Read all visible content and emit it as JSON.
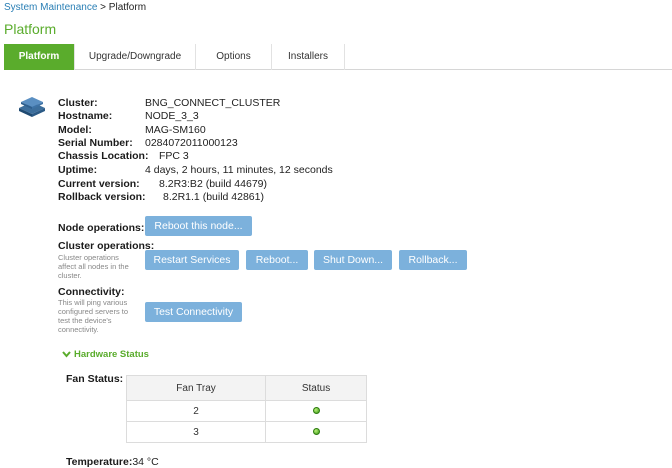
{
  "breadcrumb": {
    "parent": "System Maintenance",
    "separator": " > ",
    "current": "Platform"
  },
  "page_title": "Platform",
  "tabs": [
    {
      "label": "Platform",
      "active": true
    },
    {
      "label": "Upgrade/Downgrade",
      "active": false
    },
    {
      "label": "Options",
      "active": false
    },
    {
      "label": "Installers",
      "active": false
    }
  ],
  "info": [
    {
      "label": "Cluster:",
      "value": "BNG_CONNECT_CLUSTER"
    },
    {
      "label": "Hostname:",
      "value": "NODE_3_3"
    },
    {
      "label": "Model:",
      "value": "MAG-SM160"
    },
    {
      "label": "Serial Number:",
      "value": "0284072011000123"
    },
    {
      "label": "Chassis Location:",
      "value": "FPC 3"
    },
    {
      "label": "Uptime:",
      "value": "4 days, 2 hours, 11 minutes, 12 seconds"
    },
    {
      "label": "Current version:",
      "value": "8.2R3:B2 (build 44679)"
    },
    {
      "label": "Rollback version:",
      "value": "8.2R1.1 (build 42861)"
    }
  ],
  "node_ops": {
    "label": "Node operations:",
    "reboot_button": "Reboot this node..."
  },
  "cluster_ops": {
    "label": "Cluster operations:",
    "description": "Cluster operations affect all nodes in the cluster.",
    "buttons": [
      "Restart Services",
      "Reboot...",
      "Shut Down...",
      "Rollback..."
    ]
  },
  "connectivity": {
    "label": "Connectivity:",
    "description": "This will ping various configured servers to test the device's connectivity.",
    "button": "Test Connectivity"
  },
  "hardware": {
    "toggle_label": "Hardware Status",
    "fan_label": "Fan Status:",
    "columns": [
      "Fan Tray",
      "Status"
    ],
    "rows": [
      {
        "tray": "2",
        "status": "ok"
      },
      {
        "tray": "3",
        "status": "ok"
      }
    ],
    "temperature_label": "Temperature:",
    "temperature_value": "34 °C"
  },
  "colors": {
    "accent_green": "#5aac2c",
    "button_blue": "#7cb1dc",
    "link_blue": "#2a7fb5"
  },
  "icons": [
    "device-stack-icon",
    "chevron-down-icon",
    "status-ok-icon"
  ]
}
